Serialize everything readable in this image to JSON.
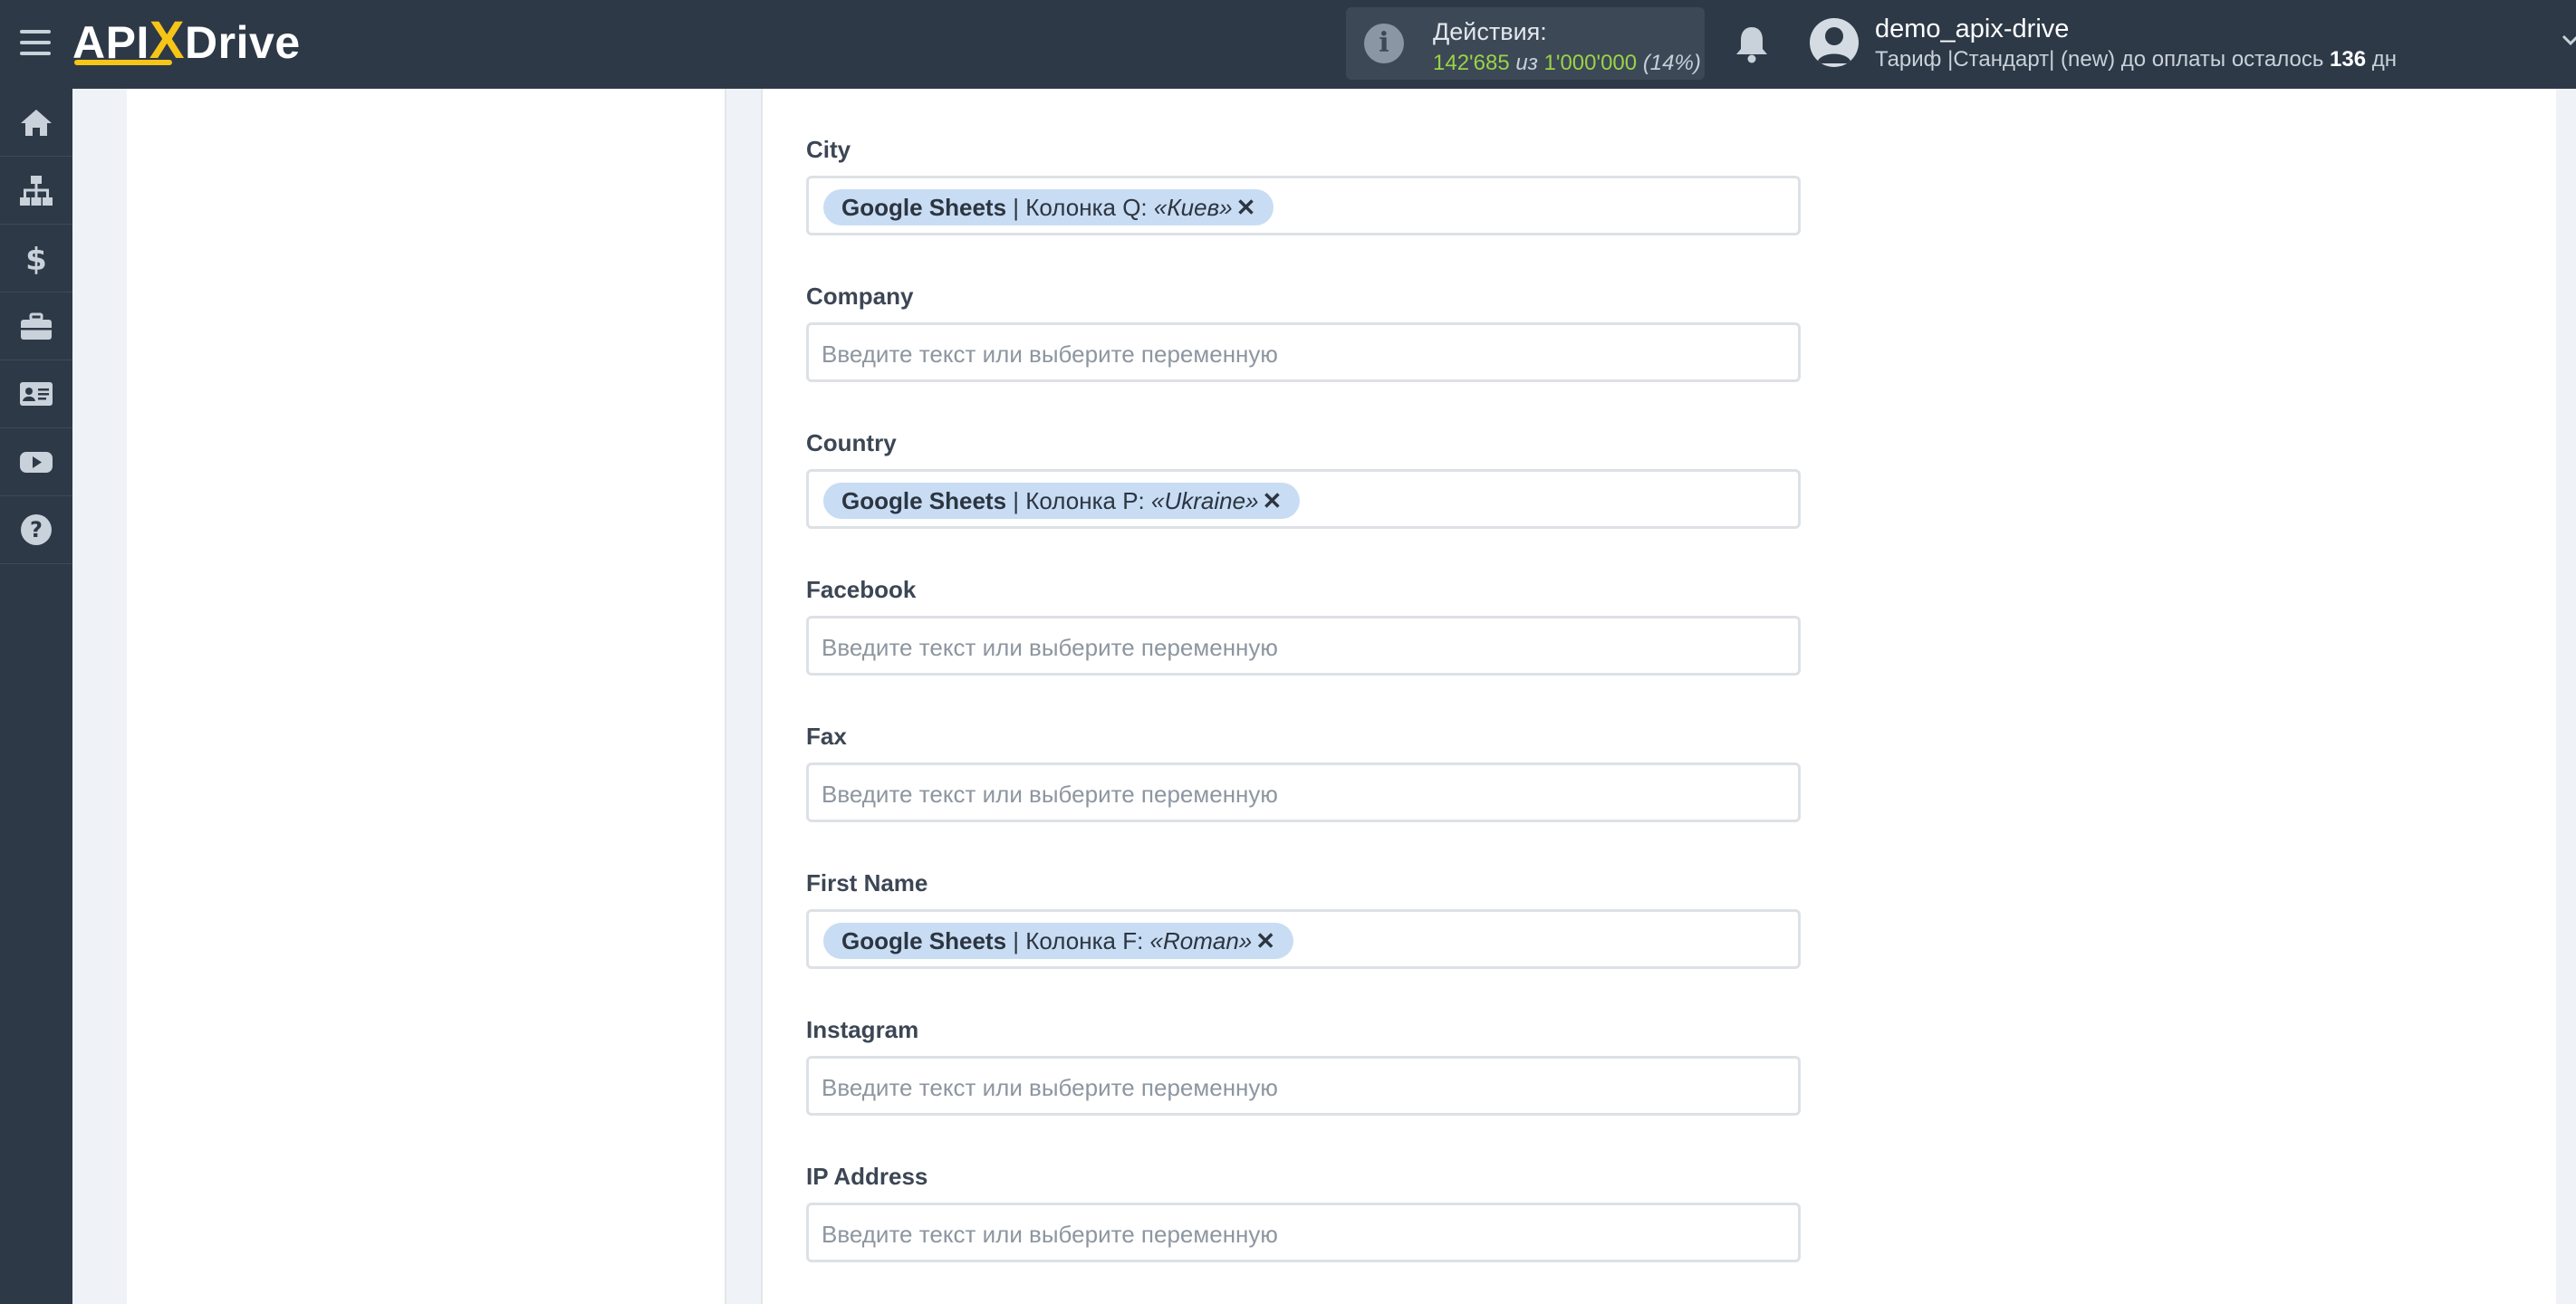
{
  "header": {
    "logo": {
      "pre": "API",
      "x": "X",
      "post": "Drive"
    },
    "actions": {
      "title": "Действия:",
      "used": "142'685",
      "of_word": "из",
      "limit": "1'000'000",
      "extra": "(14%)"
    },
    "user": {
      "name": "demo_apix-drive",
      "tariff_prefix": "Тариф |Стандарт| (new) до оплаты осталось",
      "days": "136",
      "days_suffix": "дн"
    }
  },
  "sidebar": {
    "items": [
      {
        "icon": "home-icon"
      },
      {
        "icon": "sitemap-icon"
      },
      {
        "icon": "dollar-icon"
      },
      {
        "icon": "briefcase-icon"
      },
      {
        "icon": "id-card-icon"
      },
      {
        "icon": "youtube-icon"
      },
      {
        "icon": "help-icon"
      }
    ]
  },
  "form": {
    "placeholder": "Введите текст или выберите переменную",
    "fields": [
      {
        "label": "City",
        "tag": {
          "source": "Google Sheets",
          "column": " | Колонка Q: ",
          "value": "«Киев»"
        }
      },
      {
        "label": "Company"
      },
      {
        "label": "Country",
        "tag": {
          "source": "Google Sheets",
          "column": " | Колонка P: ",
          "value": "«Ukraine»"
        }
      },
      {
        "label": "Facebook"
      },
      {
        "label": "Fax"
      },
      {
        "label": "First Name",
        "tag": {
          "source": "Google Sheets",
          "column": " | Колонка F: ",
          "value": "«Roman»"
        }
      },
      {
        "label": "Instagram"
      },
      {
        "label": "IP Address"
      }
    ],
    "remove_symbol": "✕"
  }
}
